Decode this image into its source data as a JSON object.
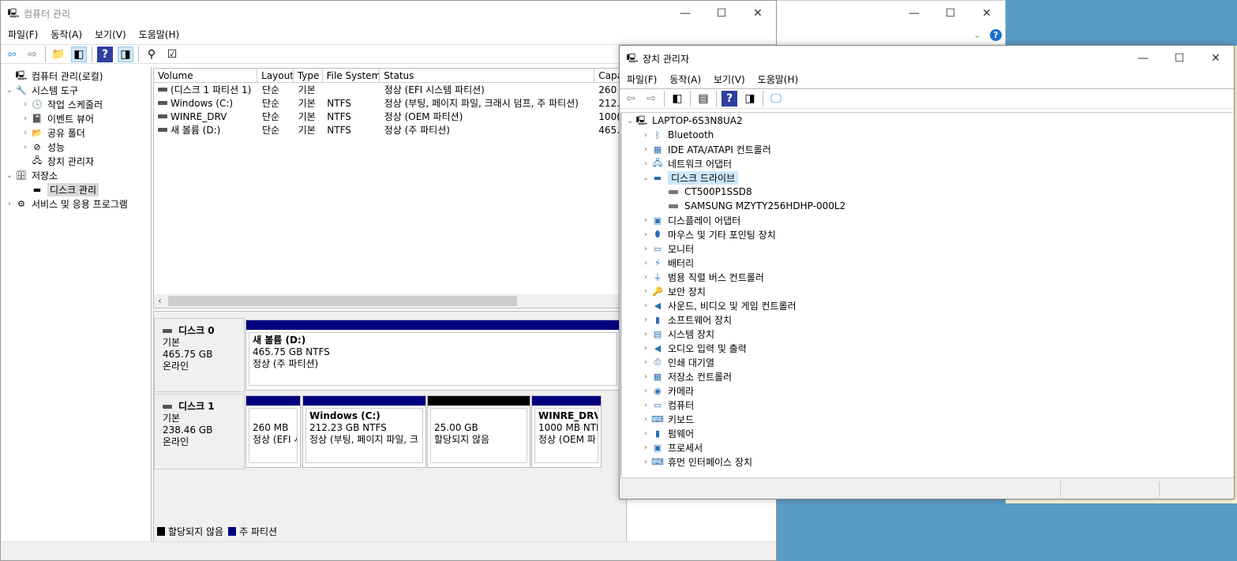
{
  "bg_window": {
    "help": "?"
  },
  "cm": {
    "title": "컴퓨터 관리",
    "menu": [
      "파일(F)",
      "동작(A)",
      "보기(V)",
      "도움말(H)"
    ],
    "tree": [
      {
        "label": "컴퓨터 관리(로컬)",
        "level": 0,
        "chev": ""
      },
      {
        "label": "시스템 도구",
        "level": 0,
        "chev": "⌄"
      },
      {
        "label": "작업 스케줄러",
        "level": 1,
        "chev": "›"
      },
      {
        "label": "이벤트 뷰어",
        "level": 1,
        "chev": "›"
      },
      {
        "label": "공유 폴더",
        "level": 1,
        "chev": "›"
      },
      {
        "label": "성능",
        "level": 1,
        "chev": "›"
      },
      {
        "label": "장치 관리자",
        "level": 1,
        "chev": ""
      },
      {
        "label": "저장소",
        "level": 0,
        "chev": "⌄"
      },
      {
        "label": "디스크 관리",
        "level": 1,
        "chev": ""
      },
      {
        "label": "서비스 및 응용 프로그램",
        "level": 0,
        "chev": "›"
      }
    ],
    "columns": [
      "Volume",
      "Layout",
      "Type",
      "File System",
      "Status",
      "Capa"
    ],
    "rows": [
      [
        "(디스크 1 파티션 1)",
        "단순",
        "기본",
        "",
        "정상 (EFI 시스템 파티션)",
        "260"
      ],
      [
        "Windows (C:)",
        "단순",
        "기본",
        "NTFS",
        "정상 (부팅, 페이지 파일, 크래시 덤프, 주 파티션)",
        "212."
      ],
      [
        "WINRE_DRV",
        "단순",
        "기본",
        "NTFS",
        "정상 (OEM 파티션)",
        "100("
      ],
      [
        "새 볼륨 (D:)",
        "단순",
        "기본",
        "NTFS",
        "정상 (주 파티션)",
        "465."
      ]
    ],
    "disks": [
      {
        "name": "디스크 0",
        "type": "기본",
        "size": "465.75 GB",
        "state": "온라인",
        "parts": [
          {
            "title": "새 볼륨  (D:)",
            "line1": "465.75 GB NTFS",
            "line2": "정상 (주 파티션)"
          }
        ]
      },
      {
        "name": "디스크 1",
        "type": "기본",
        "size": "238.46 GB",
        "state": "온라인",
        "parts": [
          {
            "title": "",
            "line1": "260 MB",
            "line2": "정상 (EFI 시"
          },
          {
            "title": "Windows  (C:)",
            "line1": "212.23 GB NTFS",
            "line2": "정상 (부팅, 페이지 파일, 크"
          },
          {
            "title": "",
            "line1": "25.00 GB",
            "line2": "할당되지 않음"
          },
          {
            "title": "WINRE_DRV",
            "line1": "1000 MB NTF",
            "line2": "정상 (OEM 파"
          }
        ]
      }
    ],
    "legend": [
      "할당되지 않음",
      "주 파티션"
    ],
    "colors": {
      "primary": "#00007f",
      "unallocated": "#000000"
    }
  },
  "dm": {
    "title": "장치 관리자",
    "menu": [
      "파일(F)",
      "동작(A)",
      "보기(V)",
      "도움말(H)"
    ],
    "root": "LAPTOP-6S3N8UA2",
    "items": [
      {
        "label": "Bluetooth",
        "icon": "bluetooth-icon",
        "g": "ᛒ"
      },
      {
        "label": "IDE ATA/ATAPI 컨트롤러",
        "icon": "ide-controller-icon",
        "g": "▦"
      },
      {
        "label": "네트워크 어댑터",
        "icon": "network-adapter-icon",
        "g": "🖧"
      },
      {
        "label": "디스크 드라이브",
        "icon": "disk-drive-icon",
        "g": "▬",
        "expanded": true,
        "children": [
          "CT500P1SSD8",
          "SAMSUNG MZYTY256HDHP-000L2"
        ]
      },
      {
        "label": "디스플레이 어댑터",
        "icon": "display-adapter-icon",
        "g": "▣"
      },
      {
        "label": "마우스 및 기타 포인팅 장치",
        "icon": "mouse-icon",
        "g": "⬮"
      },
      {
        "label": "모니터",
        "icon": "monitor-icon",
        "g": "▭"
      },
      {
        "label": "배터리",
        "icon": "battery-icon",
        "g": "⚡"
      },
      {
        "label": "범용 직렬 버스 컨트롤러",
        "icon": "usb-icon",
        "g": "⏚"
      },
      {
        "label": "보안 장치",
        "icon": "security-device-icon",
        "g": "🔑"
      },
      {
        "label": "사운드, 비디오 및 게임 컨트롤러",
        "icon": "speaker-icon",
        "g": "◀"
      },
      {
        "label": "소프트웨어 장치",
        "icon": "software-device-icon",
        "g": "▮"
      },
      {
        "label": "시스템 장치",
        "icon": "system-device-icon",
        "g": "▤"
      },
      {
        "label": "오디오 입력 및 출력",
        "icon": "audio-icon",
        "g": "◀"
      },
      {
        "label": "인쇄 대기열",
        "icon": "printer-icon",
        "g": "⎙"
      },
      {
        "label": "저장소 컨트롤러",
        "icon": "storage-controller-icon",
        "g": "▦"
      },
      {
        "label": "카메라",
        "icon": "camera-icon",
        "g": "◉"
      },
      {
        "label": "컴퓨터",
        "icon": "computer-icon",
        "g": "▭"
      },
      {
        "label": "키보드",
        "icon": "keyboard-icon",
        "g": "⌨"
      },
      {
        "label": "펌웨어",
        "icon": "firmware-icon",
        "g": "▮"
      },
      {
        "label": "프로세서",
        "icon": "processor-icon",
        "g": "▣"
      },
      {
        "label": "휴먼 인터페이스 장치",
        "icon": "hid-icon",
        "g": "⌨"
      }
    ]
  }
}
